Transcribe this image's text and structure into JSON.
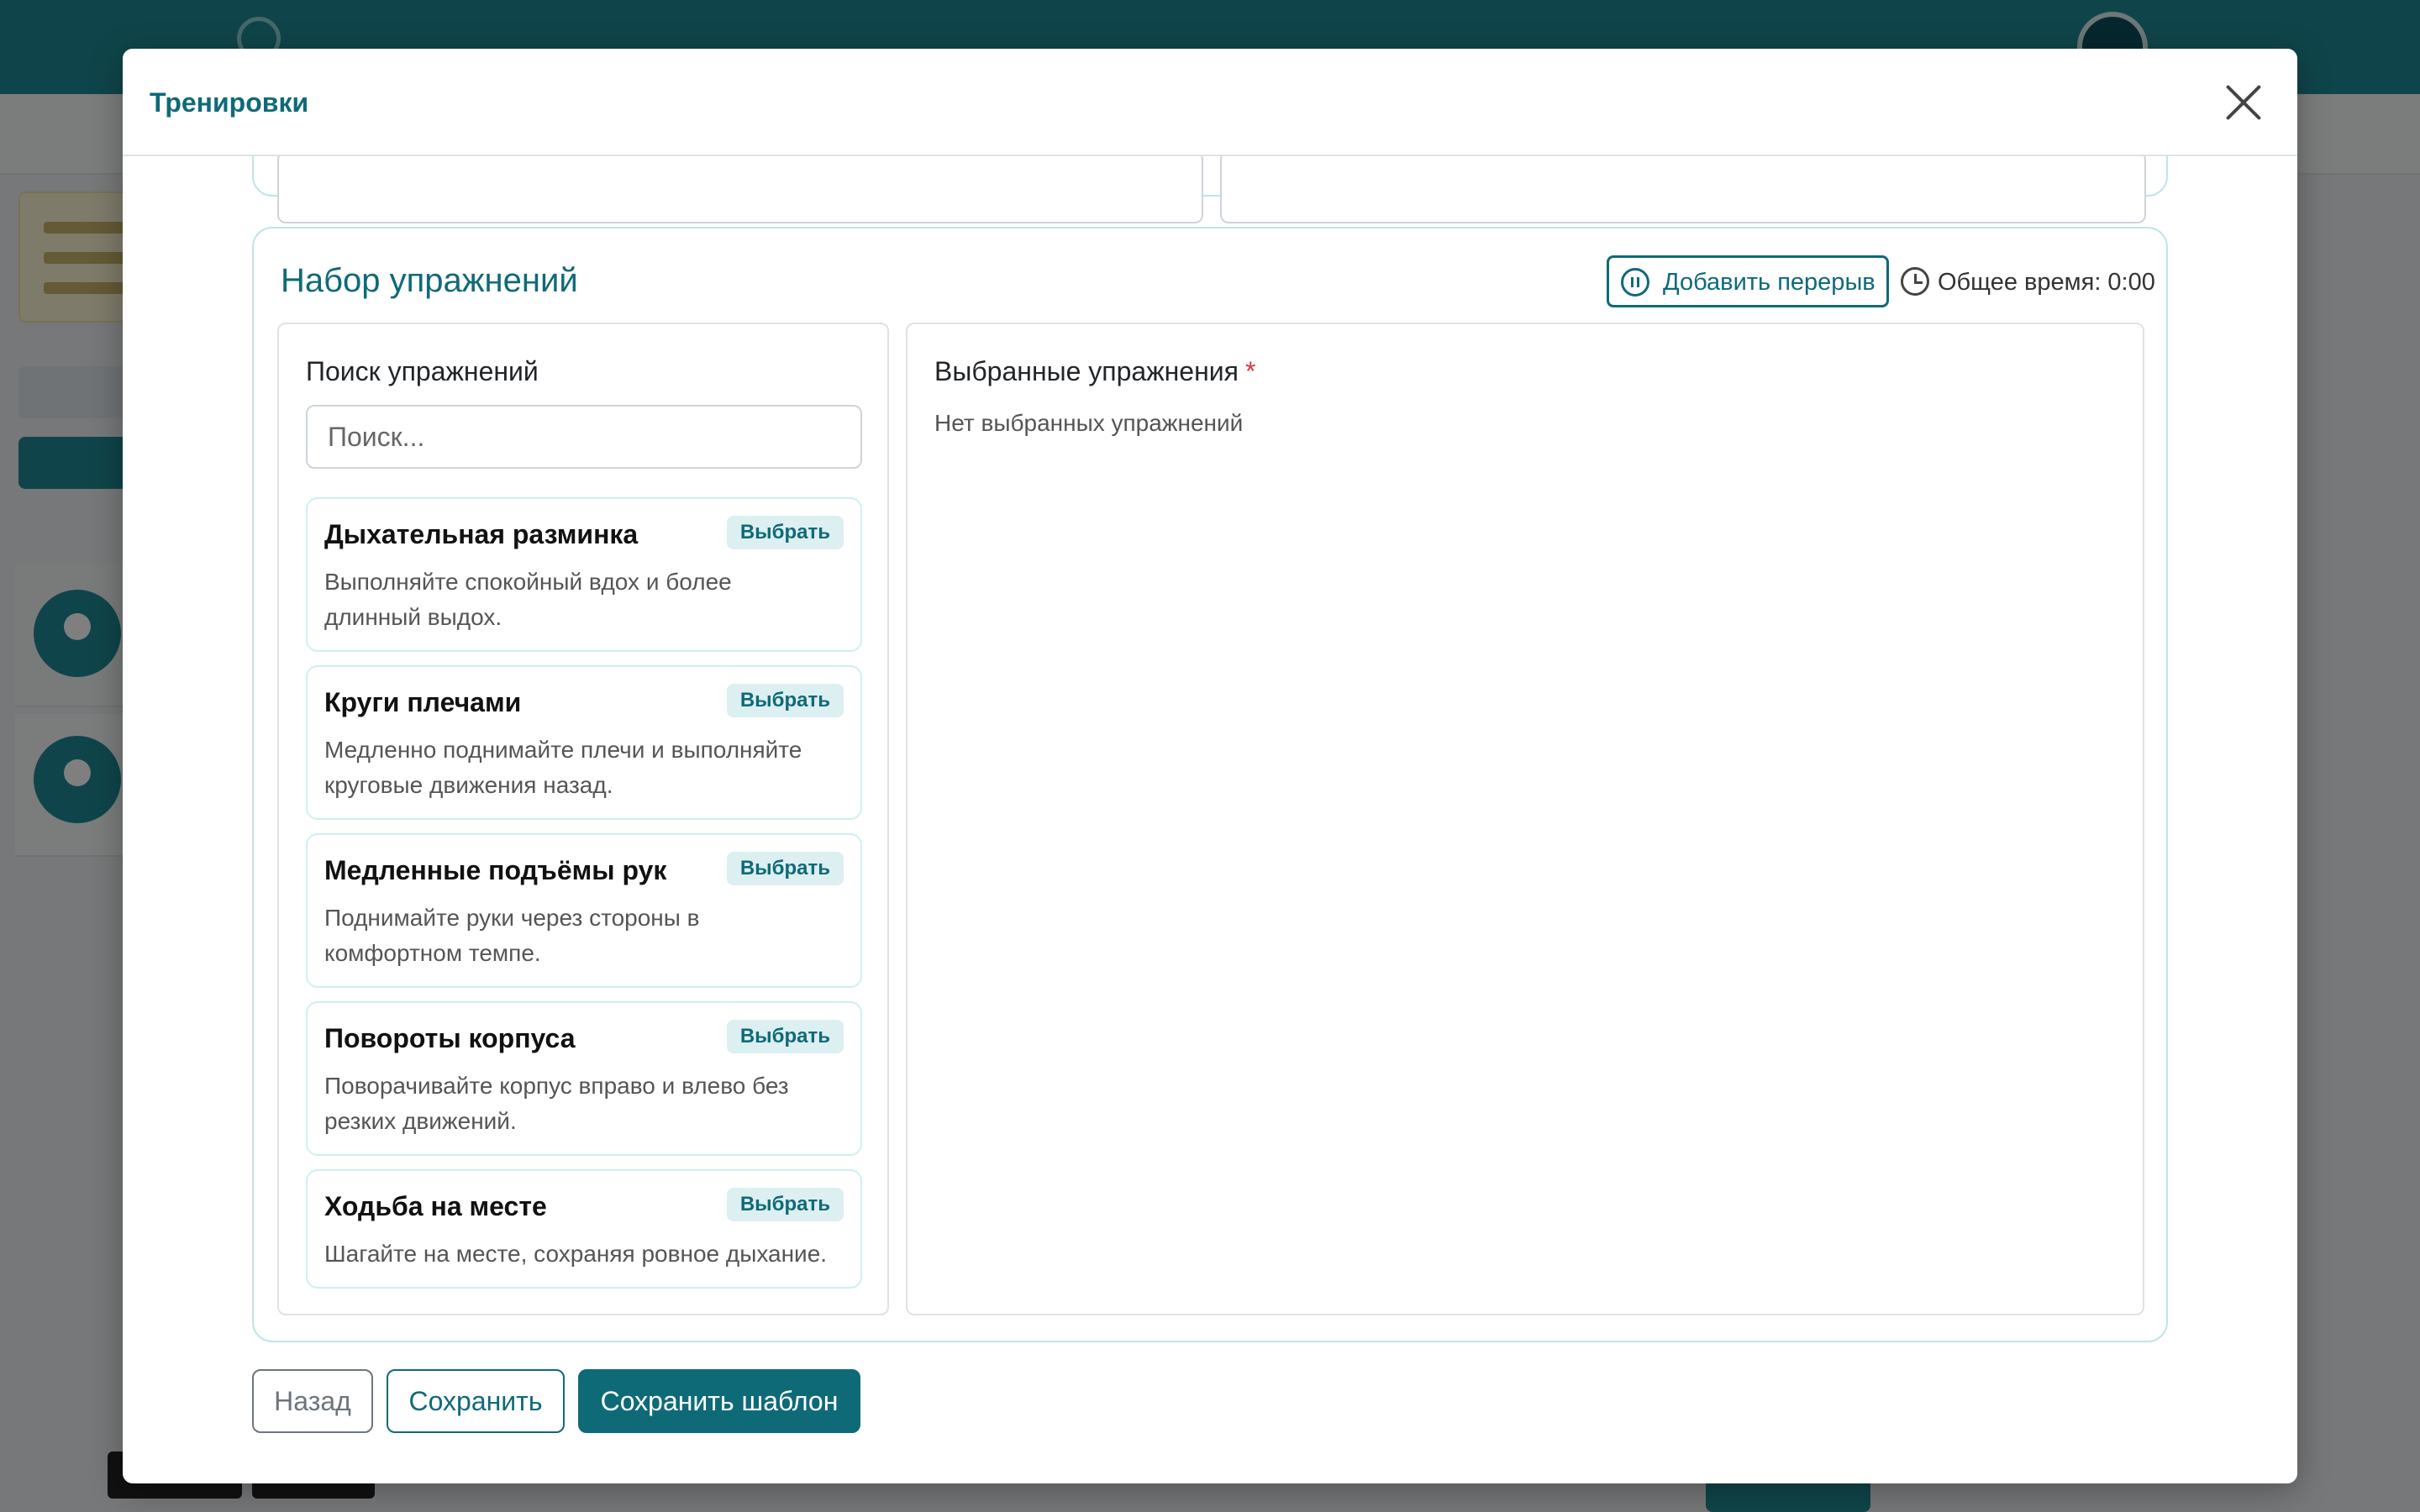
{
  "modal": {
    "title": "Тренировки"
  },
  "exercise_set": {
    "title": "Набор упражнений",
    "add_break_label": "Добавить перерыв",
    "total_time_label": "Общее время: 0:00"
  },
  "search": {
    "heading": "Поиск упражнений",
    "placeholder": "Поиск...",
    "select_label": "Выбрать",
    "exercises": [
      {
        "name": "Дыхательная разминка",
        "description": "Выполняйте спокойный вдох и более длинный выдох."
      },
      {
        "name": "Круги плечами",
        "description": "Медленно поднимайте плечи и выполняйте круговые движения назад."
      },
      {
        "name": "Медленные подъёмы рук",
        "description": "Поднимайте руки через стороны в комфортном темпе."
      },
      {
        "name": "Повороты корпуса",
        "description": "Поворачивайте корпус вправо и влево без резких движений."
      },
      {
        "name": "Ходьба на месте",
        "description": "Шагайте на месте, сохраняя ровное дыхание."
      }
    ]
  },
  "selected": {
    "heading": "Выбранные упражнения",
    "required_mark": "*",
    "empty_text": "Нет выбранных упражнений"
  },
  "footer": {
    "back_label": "Назад",
    "save_label": "Сохранить",
    "save_template_label": "Сохранить шаблон"
  },
  "colors": {
    "brand": "#0f6a78",
    "section_border": "#bfe5e8",
    "badge_bg": "#dceff1",
    "required": "#dc3545"
  },
  "icons": {
    "close": "close-icon",
    "pause": "pause-circle-icon",
    "clock": "clock-icon"
  }
}
